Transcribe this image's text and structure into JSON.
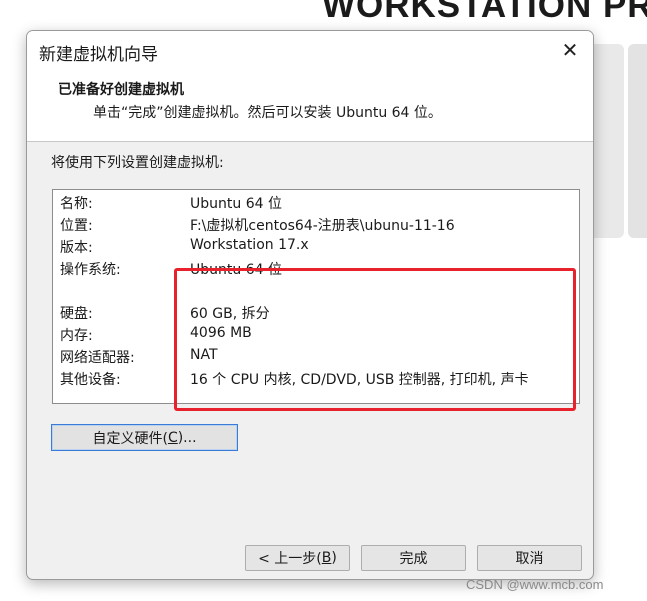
{
  "background": {
    "title_text": "WORKSTATION PR",
    "watermark": "CSDN @www.mcb.com"
  },
  "dialog": {
    "title": "新建虚拟机向导",
    "close_symbol": "✕",
    "header_title": "已准备好创建虚拟机",
    "header_subtitle": "单击“完成”创建虚拟机。然后可以安装 Ubuntu 64 位。",
    "intro": "将使用下列设置创建虚拟机:",
    "settings": [
      {
        "label": "名称:",
        "value": "Ubuntu 64 位"
      },
      {
        "label": "位置:",
        "value": "F:\\虚拟机centos64-注册表\\ubunu-11-16"
      },
      {
        "label": "版本:",
        "value": "Workstation 17.x"
      },
      {
        "label": "操作系统:",
        "value": "Ubuntu 64 位"
      },
      {
        "label": "硬盘:",
        "value": "60 GB, 拆分"
      },
      {
        "label": "内存:",
        "value": "4096 MB"
      },
      {
        "label": "网络适配器:",
        "value": "NAT"
      },
      {
        "label": "其他设备:",
        "value": "16 个 CPU 内核, CD/DVD, USB 控制器, 打印机, 声卡"
      }
    ],
    "customize_button": {
      "prefix": "自定义硬件(",
      "mnemonic": "C",
      "suffix": ")..."
    },
    "back_button": {
      "prefix": "< 上一步(",
      "mnemonic": "B",
      "suffix": ")"
    },
    "finish_label": "完成",
    "cancel_label": "取消"
  },
  "colors": {
    "highlight": "#e8222c",
    "focus": "#3a7bd5"
  }
}
